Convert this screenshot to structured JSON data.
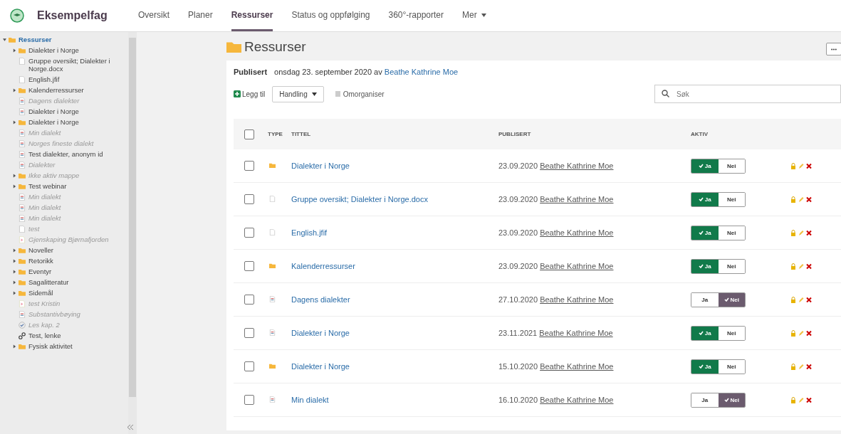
{
  "app": {
    "title": "Eksempelfag"
  },
  "tabs": [
    {
      "label": "Oversikt",
      "selected": false
    },
    {
      "label": "Planer",
      "selected": false
    },
    {
      "label": "Ressurser",
      "selected": true
    },
    {
      "label": "Status og oppfølging",
      "selected": false
    },
    {
      "label": "360°-rapporter",
      "selected": false
    },
    {
      "label": "Mer",
      "selected": false,
      "kind": "menu"
    }
  ],
  "sidebar": {
    "tree": [
      {
        "label": "Ressurser",
        "kind": "folder",
        "active": true,
        "expanded": true,
        "selected": true,
        "children": [
          {
            "label": "Dialekter i Norge",
            "kind": "folder",
            "active": true,
            "expanded": false,
            "selected": false
          },
          {
            "label": "Gruppe oversikt; Dialekter i Norge.docx",
            "kind": "file",
            "active": true,
            "selected": false
          },
          {
            "label": "English.jfif",
            "kind": "file",
            "active": true,
            "selected": false
          },
          {
            "label": "Kalenderressurser",
            "kind": "folder",
            "active": true,
            "expanded": false,
            "selected": false
          },
          {
            "label": "Dagens dialekter",
            "kind": "doc",
            "active": false,
            "selected": false
          },
          {
            "label": "Dialekter i Norge",
            "kind": "doc",
            "active": true,
            "selected": false
          },
          {
            "label": "Dialekter i Norge",
            "kind": "folder",
            "active": true,
            "expanded": false,
            "selected": false
          },
          {
            "label": "Min dialekt",
            "kind": "doc",
            "active": false,
            "selected": false
          },
          {
            "label": "Norges fineste dialekt",
            "kind": "doc",
            "active": false,
            "selected": false
          },
          {
            "label": "Test dialekter, anonym id",
            "kind": "doc",
            "active": true,
            "selected": false
          },
          {
            "label": "Dialekter",
            "kind": "doc",
            "active": false,
            "selected": false
          },
          {
            "label": "Ikke aktiv mappe",
            "kind": "folder",
            "active": false,
            "expanded": false,
            "selected": false
          },
          {
            "label": "Test webinar",
            "kind": "folder",
            "active": true,
            "expanded": false,
            "selected": false
          },
          {
            "label": "Min dialekt",
            "kind": "doc",
            "active": false,
            "selected": false
          },
          {
            "label": "Min dialekt",
            "kind": "doc",
            "active": false,
            "selected": false
          },
          {
            "label": "Min dialekt",
            "kind": "doc",
            "active": false,
            "selected": false
          },
          {
            "label": "test",
            "kind": "file",
            "active": false,
            "selected": false
          },
          {
            "label": "Gjenskaping Bjørnafjorden",
            "kind": "video",
            "active": false,
            "selected": false
          },
          {
            "label": "Noveller",
            "kind": "folder",
            "active": true,
            "expanded": false,
            "selected": false
          },
          {
            "label": "Retorikk",
            "kind": "folder",
            "active": true,
            "expanded": false,
            "selected": false
          },
          {
            "label": "Eventyr",
            "kind": "folder",
            "active": true,
            "expanded": false,
            "selected": false
          },
          {
            "label": "Sagalitteratur",
            "kind": "folder",
            "active": true,
            "expanded": false,
            "selected": false
          },
          {
            "label": "Sidemål",
            "kind": "folder",
            "active": true,
            "expanded": false,
            "selected": false
          },
          {
            "label": "test Kristin",
            "kind": "video",
            "active": false,
            "selected": false
          },
          {
            "label": "Substantivbøying",
            "kind": "doc",
            "active": false,
            "selected": false
          },
          {
            "label": "Les kap. 2",
            "kind": "task",
            "active": false,
            "selected": false
          },
          {
            "label": "Test, lenke",
            "kind": "link",
            "active": true,
            "selected": false
          },
          {
            "label": "Fysisk aktivitet",
            "kind": "folder",
            "active": true,
            "expanded": false,
            "selected": false
          }
        ]
      }
    ]
  },
  "page": {
    "title": "Ressurser",
    "published_label": "Publisert",
    "published_text": "onsdag 23. september 2020 av",
    "published_by": "Beathe Kathrine Moe"
  },
  "toolbar": {
    "add": "Legg til",
    "action": "Handling",
    "reorder": "Omorganiser",
    "search": {
      "placeholder": "Søk"
    }
  },
  "table": {
    "columns": [
      "TYPE",
      "TITTEL",
      "PUBLISERT",
      "AKTIV"
    ],
    "select_all": {
      "checked": false
    },
    "rows": [
      {
        "kind": "folder",
        "title": "Dialekter i Norge",
        "date": "23.09.2020",
        "author": "Beathe Kathrine Moe",
        "active": true,
        "checked": false,
        "yes": "Ja",
        "no": "Nei"
      },
      {
        "kind": "file",
        "title": "Gruppe oversikt; Dialekter i Norge.docx",
        "date": "23.09.2020",
        "author": "Beathe Kathrine Moe",
        "active": true,
        "checked": false,
        "yes": "Ja",
        "no": "Nei"
      },
      {
        "kind": "file",
        "title": "English.jfif",
        "date": "23.09.2020",
        "author": "Beathe Kathrine Moe",
        "active": true,
        "checked": false,
        "yes": "Ja",
        "no": "Nei"
      },
      {
        "kind": "folder",
        "title": "Kalenderressurser",
        "date": "23.09.2020",
        "author": "Beathe Kathrine Moe",
        "active": true,
        "checked": false,
        "yes": "Ja",
        "no": "Nei"
      },
      {
        "kind": "doc",
        "title": "Dagens dialekter",
        "date": "27.10.2020",
        "author": "Beathe Kathrine Moe",
        "active": false,
        "checked": false,
        "yes": "Ja",
        "no": "Nei"
      },
      {
        "kind": "doc",
        "title": "Dialekter i Norge",
        "date": "23.11.2021",
        "author": "Beathe Kathrine Moe",
        "active": true,
        "checked": false,
        "yes": "Ja",
        "no": "Nei"
      },
      {
        "kind": "folder",
        "title": "Dialekter i Norge",
        "date": "15.10.2020",
        "author": "Beathe Kathrine Moe",
        "active": true,
        "checked": false,
        "yes": "Ja",
        "no": "Nei"
      },
      {
        "kind": "doc",
        "title": "Min dialekt",
        "date": "16.10.2020",
        "author": "Beathe Kathrine Moe",
        "active": false,
        "checked": false,
        "yes": "Ja",
        "no": "Nei"
      }
    ]
  }
}
